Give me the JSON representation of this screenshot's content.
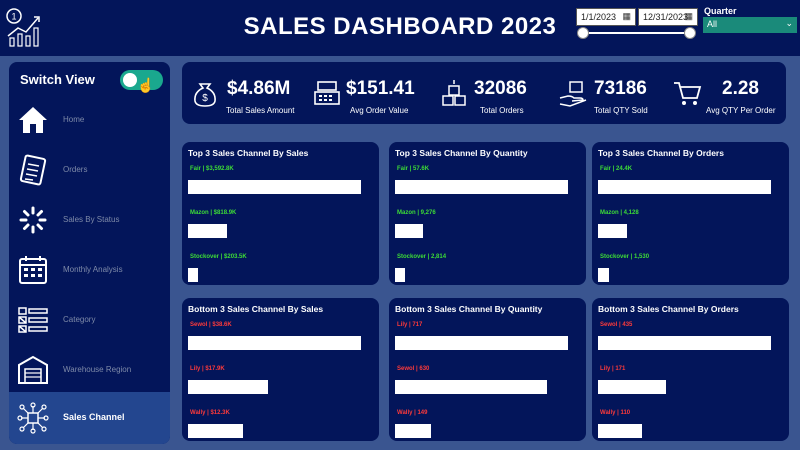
{
  "header": {
    "title": "SALES DASHBOARD 2023",
    "start_date": "1/1/2023",
    "end_date": "12/31/2023",
    "date_range_start_fraction": 0.0,
    "date_range_end_fraction": 1.0,
    "quarter_label": "Quarter",
    "quarter_value": "All"
  },
  "sidebar": {
    "switch_label": "Switch View",
    "toggle_on": true,
    "items": [
      {
        "label": "Home",
        "icon": "home-icon",
        "active": false
      },
      {
        "label": "Orders",
        "icon": "orders-icon",
        "active": false
      },
      {
        "label": "Sales By Status",
        "icon": "status-spinner-icon",
        "active": false
      },
      {
        "label": "Monthly Analysis",
        "icon": "calendar-icon",
        "active": false
      },
      {
        "label": "Category",
        "icon": "category-list-icon",
        "active": false
      },
      {
        "label": "Warehouse Region",
        "icon": "warehouse-icon",
        "active": false
      },
      {
        "label": "Sales Channel",
        "icon": "network-icon",
        "active": true
      }
    ]
  },
  "kpis": [
    {
      "value": "$4.86M",
      "label": "Total Sales Amount",
      "icon": "money-bag-icon"
    },
    {
      "value": "$151.41",
      "label": "Avg Order Value",
      "icon": "cash-register-icon"
    },
    {
      "value": "32086",
      "label": "Total Orders",
      "icon": "boxes-icon"
    },
    {
      "value": "73186",
      "label": "Total QTY Sold",
      "icon": "hand-box-icon"
    },
    {
      "value": "2.28",
      "label": "Avg QTY Per Order",
      "icon": "cart-icon"
    }
  ],
  "cards": [
    {
      "title": "Top 3 Sales Channel By Sales",
      "color": "green",
      "rows": [
        {
          "label": "Fair | $3,592.8K",
          "value": 3592.8
        },
        {
          "label": "Mazon | $818.9K",
          "value": 818.9
        },
        {
          "label": "Stockover | $203.5K",
          "value": 203.5
        }
      ]
    },
    {
      "title": "Top 3 Sales Channel By Quantity",
      "color": "green",
      "rows": [
        {
          "label": "Fair | 57.6K",
          "value": 57600
        },
        {
          "label": "Mazon | 9,276",
          "value": 9276
        },
        {
          "label": "Stockover | 2,814",
          "value": 2814
        }
      ]
    },
    {
      "title": "Top 3 Sales Channel By Orders",
      "color": "green",
      "rows": [
        {
          "label": "Fair | 24.4K",
          "value": 24400
        },
        {
          "label": "Mazon | 4,128",
          "value": 4128
        },
        {
          "label": "Stockover | 1,530",
          "value": 1530
        }
      ]
    },
    {
      "title": "Bottom 3 Sales Channel By Sales",
      "color": "red",
      "rows": [
        {
          "label": "Sewol | $38.6K",
          "value": 38.6
        },
        {
          "label": "Lily | $17.9K",
          "value": 17.9
        },
        {
          "label": "Wally | $12.3K",
          "value": 12.3
        }
      ]
    },
    {
      "title": "Bottom 3 Sales Channel By Quantity",
      "color": "red",
      "rows": [
        {
          "label": "Lily | 717",
          "value": 717
        },
        {
          "label": "Sewol | 630",
          "value": 630
        },
        {
          "label": "Wally | 149",
          "value": 149
        }
      ]
    },
    {
      "title": "Bottom 3 Sales Channel By Orders",
      "color": "red",
      "rows": [
        {
          "label": "Sewol | 435",
          "value": 435
        },
        {
          "label": "Lily | 171",
          "value": 171
        },
        {
          "label": "Wally | 110",
          "value": 110
        }
      ]
    }
  ],
  "colors": {
    "header_bg": "#03155a",
    "page_bg": "#3a5590",
    "active_nav": "#23468f",
    "toggle": "#1aa88e",
    "top_label": "#3ddc36",
    "bottom_label": "#ff3a3a"
  }
}
